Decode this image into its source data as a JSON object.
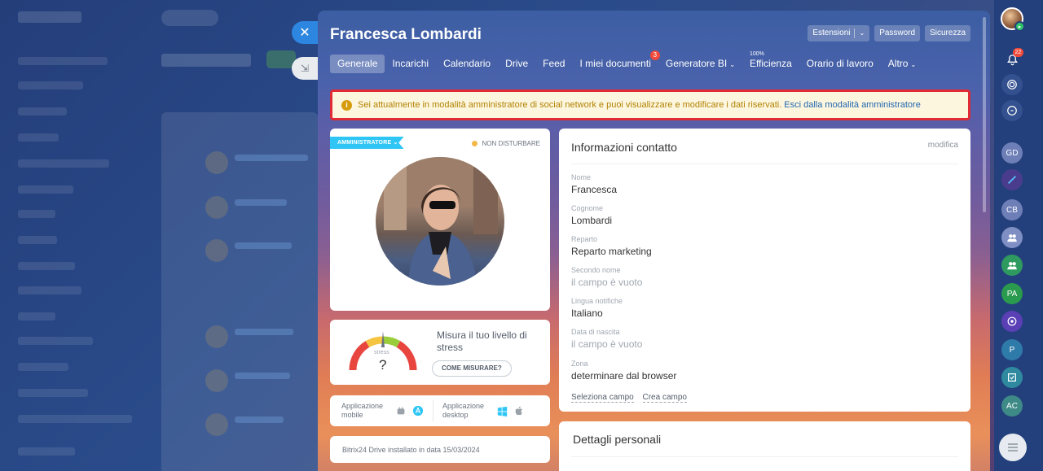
{
  "profile": {
    "name": "Francesca Lombardi",
    "top_buttons": [
      "Estensioni",
      "Password",
      "Sicurezza"
    ]
  },
  "tabs": [
    {
      "label": "Generale"
    },
    {
      "label": "Incarichi"
    },
    {
      "label": "Calendario"
    },
    {
      "label": "Drive"
    },
    {
      "label": "Feed"
    },
    {
      "label": "I miei documenti",
      "badge": "3"
    },
    {
      "label": "Generatore BI",
      "chevron": "⌄"
    },
    {
      "label": "Efficienza",
      "sup": "100%"
    },
    {
      "label": "Orario di lavoro"
    },
    {
      "label": "Altro",
      "chevron": "⌄"
    }
  ],
  "alert": {
    "text": "Sei attualmente in modalità amministratore di social network e puoi visualizzare e modificare i dati riservati.",
    "link": "Esci dalla modalità amministratore"
  },
  "avatar_card": {
    "role_tag": "AMMINISTRATORE",
    "status": "NON DISTURBARE"
  },
  "stress": {
    "gauge_label": "stress",
    "gauge_value": "?",
    "text": "Misura il tuo livello di stress",
    "button": "COME MISURARE?"
  },
  "apps": {
    "mobile": "Applicazione mobile",
    "desktop": "Applicazione desktop"
  },
  "drive": {
    "text": "Bitrix24 Drive installato in data 15/03/2024"
  },
  "contact": {
    "title": "Informazioni contatto",
    "edit": "modifica",
    "fields": [
      {
        "label": "Nome",
        "value": "Francesca",
        "empty": false
      },
      {
        "label": "Cognome",
        "value": "Lombardi",
        "empty": false
      },
      {
        "label": "Reparto",
        "value": "Reparto marketing",
        "empty": false
      },
      {
        "label": "Secondo nome",
        "value": "il campo è vuoto",
        "empty": true
      },
      {
        "label": "Lingua notifiche",
        "value": "Italiano",
        "empty": false
      },
      {
        "label": "Data di nascita",
        "value": "il campo è vuoto",
        "empty": true
      },
      {
        "label": "Zona",
        "value": "determinare dal browser",
        "empty": false
      }
    ],
    "links": [
      "Seleziona campo",
      "Crea campo"
    ]
  },
  "personal": {
    "title": "Dettagli personali"
  },
  "rail": {
    "notification_count": "22",
    "items": [
      "GD",
      "CB",
      "PA",
      "P",
      "AC"
    ]
  },
  "colors": {
    "accent": "#2fc6f6",
    "alert_border": "#e02a35",
    "alert_bg": "#fdf6df",
    "link": "#2067b0"
  }
}
